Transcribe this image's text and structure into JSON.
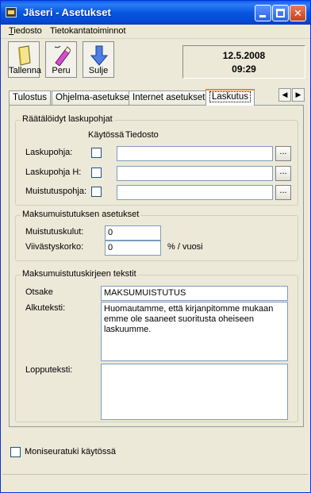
{
  "window": {
    "title": "Jäseri - Asetukset"
  },
  "menu": {
    "file_first": "T",
    "file_rest": "iedosto",
    "db": "Tietokantatoiminnot"
  },
  "toolbar": {
    "save": "Tallenna",
    "undo": "Peru",
    "close": "Sulje"
  },
  "datetime": {
    "date": "12.5.2008",
    "time": "09:29"
  },
  "tabs": [
    "Tulostus",
    "Ohjelma-asetukset",
    "Internet asetukset",
    "Laskutus"
  ],
  "templates": {
    "title": "Räätälöidyt laskupohjat",
    "col_use": "Käytössä",
    "col_file": "Tiedosto",
    "rows": [
      {
        "label": "Laskupohja:",
        "value": ""
      },
      {
        "label": "Laskupohja H:",
        "value": ""
      },
      {
        "label": "Muistutuspohja:",
        "value": ""
      }
    ],
    "browse": "..."
  },
  "reminder": {
    "title": "Maksumuistutuksen asetukset",
    "fee_label": "Muistutuskulut:",
    "fee_value": "0",
    "interest_label": "Viivästyskorko:",
    "interest_value": "0",
    "interest_unit": "% / vuosi"
  },
  "letter": {
    "title": "Maksumuistutuskirjeen tekstit",
    "subject_label": "Otsake",
    "subject_value": "MAKSUMUISTUTUS",
    "intro_label": "Alkuteksti:",
    "intro_value": "Huomautamme, että kirjanpitomme mukaan emme ole saaneet suoritusta oheiseen laskuumme.",
    "outro_label": "Lopputeksti:",
    "outro_value": ""
  },
  "multiclub": {
    "label": "Moniseuratuki käytössä"
  }
}
